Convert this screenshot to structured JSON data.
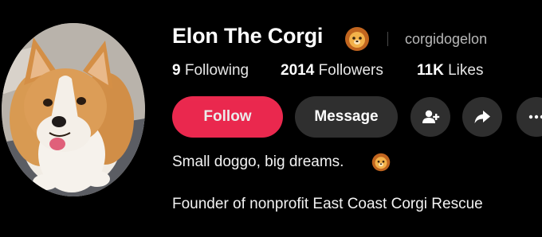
{
  "profile": {
    "display_name": "Elon The Corgi",
    "name_emoji": "lion-face-emoji",
    "handle": "corgidogelon"
  },
  "stats": {
    "following_count": "9",
    "following_label": "Following",
    "followers_count": "2014",
    "followers_label": "Followers",
    "likes_count": "11K",
    "likes_label": "Likes"
  },
  "actions": {
    "follow_label": "Follow",
    "message_label": "Message",
    "add_friend_icon": "add-friend-icon",
    "share_icon": "share-icon",
    "more_icon": "more-icon"
  },
  "bio": {
    "line1": "Small doggo, big dreams.",
    "line1_emoji": "lion-face-emoji",
    "line2": "Founder of nonprofit East Coast Corgi Rescue"
  },
  "colors": {
    "background": "#000000",
    "follow_button": "#fe2c55",
    "secondary_button": "#2f2f2f",
    "handle_text": "#b8b8b8"
  }
}
